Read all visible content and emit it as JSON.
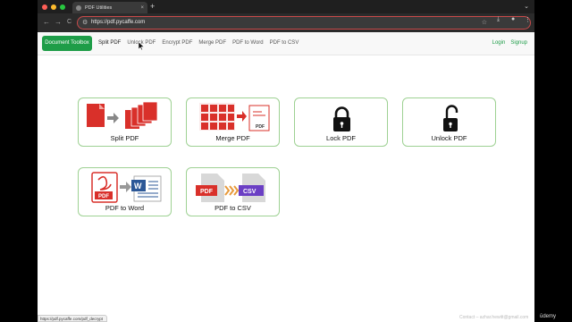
{
  "browser": {
    "tab_title": "PDF Utilities",
    "tab_close": "×",
    "new_tab": "+",
    "tab_menu": "⌄",
    "url": "https://pdf.pycaffe.com",
    "back": "←",
    "forward": "→",
    "reload": "C",
    "site_info_icon": "⚙",
    "bookmark_icon": "☆",
    "download_icon": "⤓",
    "profile_icon": "●",
    "menu_icon": "⋮",
    "status_url": "https://pdf.pycaffe.com/pdf_decrypt"
  },
  "nav": {
    "brand": "Document Toolbox",
    "links": [
      "Split PDF",
      "Unlock PDF",
      "Encrypt PDF",
      "Merge PDF",
      "PDF to Word",
      "PDF to CSV"
    ],
    "login": "Login",
    "signup": "Signup"
  },
  "cards": [
    {
      "label": "Split PDF",
      "icon": "split-pdf-icon"
    },
    {
      "label": "Merge PDF",
      "icon": "merge-pdf-icon"
    },
    {
      "label": "Lock PDF",
      "icon": "lock-icon"
    },
    {
      "label": "Unlock PDF",
      "icon": "unlock-icon"
    },
    {
      "label": "PDF to Word",
      "icon": "pdf-to-word-icon"
    },
    {
      "label": "PDF to CSV",
      "icon": "pdf-to-csv-icon"
    }
  ],
  "icon_text": {
    "pdf": "PDF",
    "word": "W",
    "csv": "CSV"
  },
  "footer": {
    "contact": "Contact – azhar.hewitt@gmail.com",
    "watermark": "ūdemy"
  },
  "colors": {
    "brand_green": "#1e9d48",
    "card_border": "#9ed193",
    "pdf_red": "#d9302a",
    "csv_purple": "#6b3fc4",
    "word_blue": "#2b5797"
  }
}
